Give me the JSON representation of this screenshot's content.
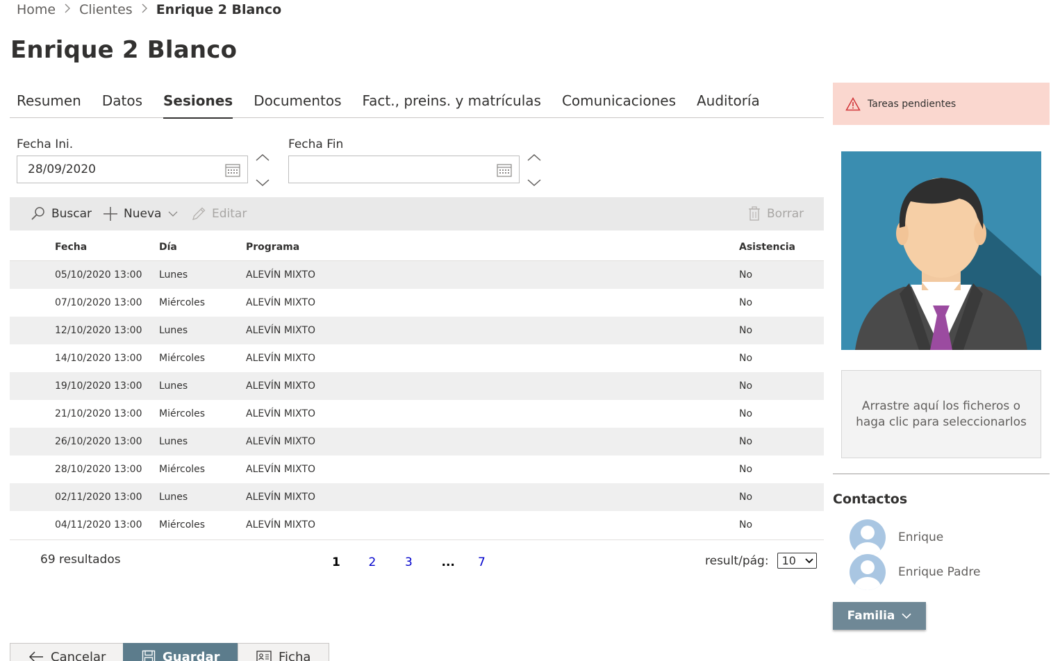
{
  "breadcrumb": {
    "home": "Home",
    "clients": "Clientes",
    "current": "Enrique 2 Blanco"
  },
  "page_title": "Enrique 2 Blanco",
  "tabs": [
    {
      "label": "Resumen"
    },
    {
      "label": "Datos"
    },
    {
      "label": "Sesiones",
      "active": true
    },
    {
      "label": "Documentos"
    },
    {
      "label": "Fact., preins. y matrículas"
    },
    {
      "label": "Comunicaciones"
    },
    {
      "label": "Auditoría"
    }
  ],
  "filters": {
    "start": {
      "label": "Fecha Ini.",
      "value": "28/09/2020"
    },
    "end": {
      "label": "Fecha Fin",
      "value": ""
    }
  },
  "toolbar": {
    "search": "Buscar",
    "new": "Nueva",
    "edit": "Editar",
    "delete": "Borrar"
  },
  "table": {
    "headers": {
      "fecha": "Fecha",
      "dia": "Día",
      "programa": "Programa",
      "asistencia": "Asistencia"
    },
    "rows": [
      {
        "fecha": "05/10/2020 13:00",
        "dia": "Lunes",
        "programa": "ALEVÍN MIXTO",
        "asistencia": "No"
      },
      {
        "fecha": "07/10/2020 13:00",
        "dia": "Miércoles",
        "programa": "ALEVÍN MIXTO",
        "asistencia": "No"
      },
      {
        "fecha": "12/10/2020 13:00",
        "dia": "Lunes",
        "programa": "ALEVÍN MIXTO",
        "asistencia": "No"
      },
      {
        "fecha": "14/10/2020 13:00",
        "dia": "Miércoles",
        "programa": "ALEVÍN MIXTO",
        "asistencia": "No"
      },
      {
        "fecha": "19/10/2020 13:00",
        "dia": "Lunes",
        "programa": "ALEVÍN MIXTO",
        "asistencia": "No"
      },
      {
        "fecha": "21/10/2020 13:00",
        "dia": "Miércoles",
        "programa": "ALEVÍN MIXTO",
        "asistencia": "No"
      },
      {
        "fecha": "26/10/2020 13:00",
        "dia": "Lunes",
        "programa": "ALEVÍN MIXTO",
        "asistencia": "No"
      },
      {
        "fecha": "28/10/2020 13:00",
        "dia": "Miércoles",
        "programa": "ALEVÍN MIXTO",
        "asistencia": "No"
      },
      {
        "fecha": "02/11/2020 13:00",
        "dia": "Lunes",
        "programa": "ALEVÍN MIXTO",
        "asistencia": "No"
      },
      {
        "fecha": "04/11/2020 13:00",
        "dia": "Miércoles",
        "programa": "ALEVÍN MIXTO",
        "asistencia": "No"
      }
    ]
  },
  "pagination": {
    "results": "69 resultados",
    "pages": [
      "1",
      "2",
      "3",
      "...",
      "7"
    ],
    "current_page": "1",
    "per_page_label": "result/pág:",
    "per_page_value": "10"
  },
  "actions": {
    "cancel": "Cancelar",
    "save": "Guardar",
    "card": "Ficha"
  },
  "sidebar": {
    "tasks": "Tareas pendientes",
    "dropzone": "Arrastre aquí los ficheros o haga clic para seleccionarlos",
    "contacts_title": "Contactos",
    "contacts": [
      {
        "name": "Enrique"
      },
      {
        "name": "Enrique Padre"
      }
    ],
    "family_button": "Familia"
  },
  "colors": {
    "accent": "#5c7c8c",
    "tasks_bg": "#fad7cf",
    "warning": "#d13438",
    "link": "#0000cc",
    "row_alt": "#efefef"
  },
  "icons": [
    "chevron-right-icon",
    "calendar-icon",
    "chevron-up-icon",
    "chevron-down-icon",
    "search-icon",
    "plus-icon",
    "pencil-icon",
    "trash-icon",
    "arrow-left-icon",
    "save-icon",
    "id-card-icon",
    "warning-icon",
    "user-avatar-icon"
  ]
}
